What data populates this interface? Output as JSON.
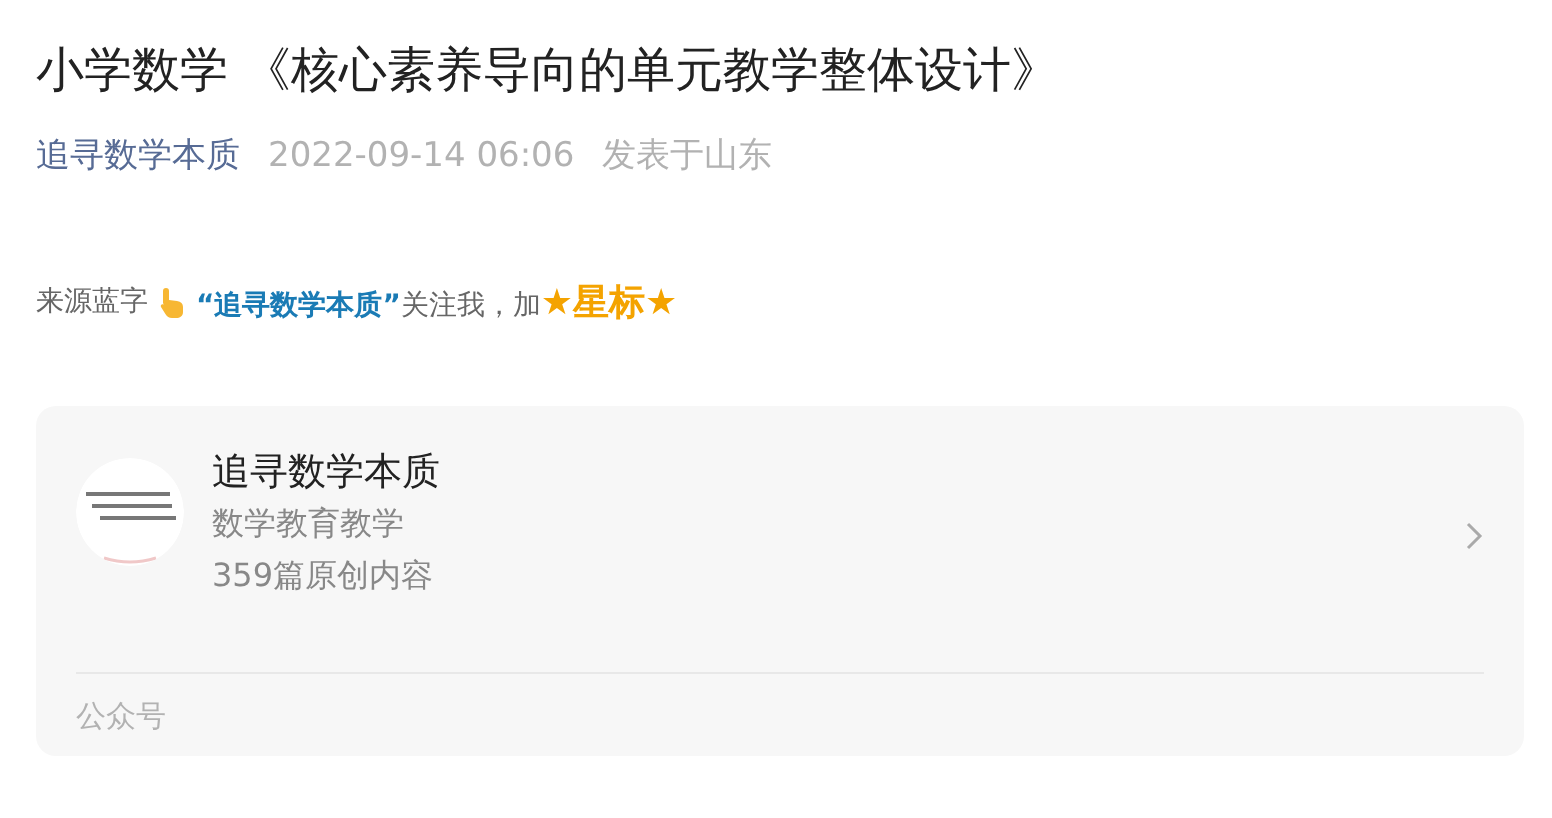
{
  "article": {
    "title": "小学数学 《核心素养导向的单元教学整体设计》",
    "author": "追寻数学本质",
    "date": "2022-09-14 06:06",
    "location": "发表于山东"
  },
  "intro": {
    "lead": "来源蓝字",
    "parts": [
      {
        "kind": "highlight",
        "text": "“追寻数学本质”"
      },
      {
        "kind": "plain",
        "text": "关注我，加"
      },
      {
        "kind": "star",
        "text": "★星标★"
      }
    ]
  },
  "account_card": {
    "name": "追寻数学本质",
    "category": "数学教育教学",
    "count": "359篇原创内容",
    "footer": "公众号"
  }
}
